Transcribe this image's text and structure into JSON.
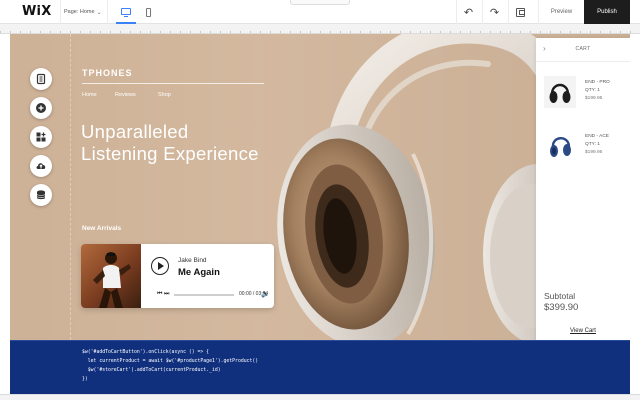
{
  "toolbar": {
    "logo": "WiX",
    "page_label": "Page: Home",
    "preview_label": "Preview",
    "publish_label": "Publish"
  },
  "site": {
    "brand": "TPHONES",
    "nav": [
      "Home",
      "Reviews",
      "Shop"
    ],
    "headline_line1": "Unparalleled",
    "headline_line2": "Listening Experience",
    "section_label": "New Arrivals"
  },
  "player": {
    "artist": "Jake Bind",
    "track": "Me Again",
    "time": "00:00 / 03:04"
  },
  "cart": {
    "title": "CART",
    "items": [
      {
        "name": "END - PRO",
        "qty": "QTY: 1",
        "price": "$199.95",
        "color": "#1c1c1c"
      },
      {
        "name": "END - ACE",
        "qty": "QTY: 1",
        "price": "$199.95",
        "color": "#2c4a86"
      }
    ],
    "subtotal_label": "Subtotal",
    "subtotal_value": "$399.90",
    "view_cart": "View Cart"
  },
  "code": {
    "lines": [
      "$w('#addToCartButton').onClick(async () => {",
      "  let currentProduct = await $w('#productPage1').getProduct()",
      "  $w('#storeCart').addToCart(currentProduct._id)",
      "})"
    ]
  },
  "colors": {
    "accent": "#3b82f6",
    "canvas_bg": "#d1b59a",
    "code_bg": "#10307e",
    "publish_bg": "#1d1d1d"
  },
  "icons": [
    "desktop-icon",
    "mobile-icon",
    "undo-icon",
    "redo-icon",
    "save-icon",
    "pages-icon",
    "add-icon",
    "add-apps-icon",
    "upload-icon",
    "database-icon",
    "play-icon",
    "skip-back-icon",
    "skip-forward-icon",
    "volume-icon",
    "chevron-right-icon"
  ]
}
